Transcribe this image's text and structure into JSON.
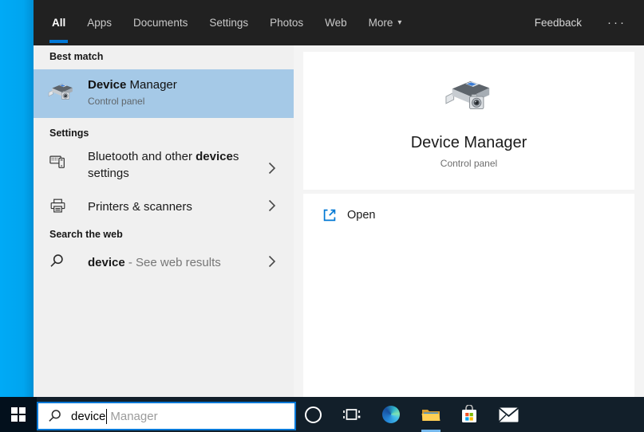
{
  "topbar": {
    "tabs": [
      "All",
      "Apps",
      "Documents",
      "Settings",
      "Photos",
      "Web",
      "More"
    ],
    "more_arrow": "▾",
    "feedback_label": "Feedback",
    "overflow_label": "···"
  },
  "left_pane": {
    "best_match_header": "Best match",
    "best_match": {
      "name_bold": "Device",
      "name_rest": " Manager",
      "type": "Control panel"
    },
    "settings_header": "Settings",
    "bluetooth_item": {
      "pre": "Bluetooth and other ",
      "match": "device",
      "post": "s settings"
    },
    "printers_item": {
      "label": "Printers & scanners"
    },
    "web_header": "Search the web",
    "web_item": {
      "match": "device",
      "rest": " - See web results"
    }
  },
  "preview_pane": {
    "title": "Device Manager",
    "subtitle": "Control panel",
    "open_label": "Open"
  },
  "search_bar": {
    "typed": "device",
    "suggestion": "Manager"
  },
  "taskbar": {
    "icons": [
      "start",
      "cortana",
      "task-view",
      "edge",
      "file-explorer",
      "store",
      "mail"
    ],
    "active_icon": "file-explorer"
  },
  "colors": {
    "accent": "#0078d7",
    "selection": "#a5c9e7",
    "topbar_bg": "#212121",
    "taskbar_bg": "#121f2a",
    "desktop_blue": "#00a7f3"
  }
}
